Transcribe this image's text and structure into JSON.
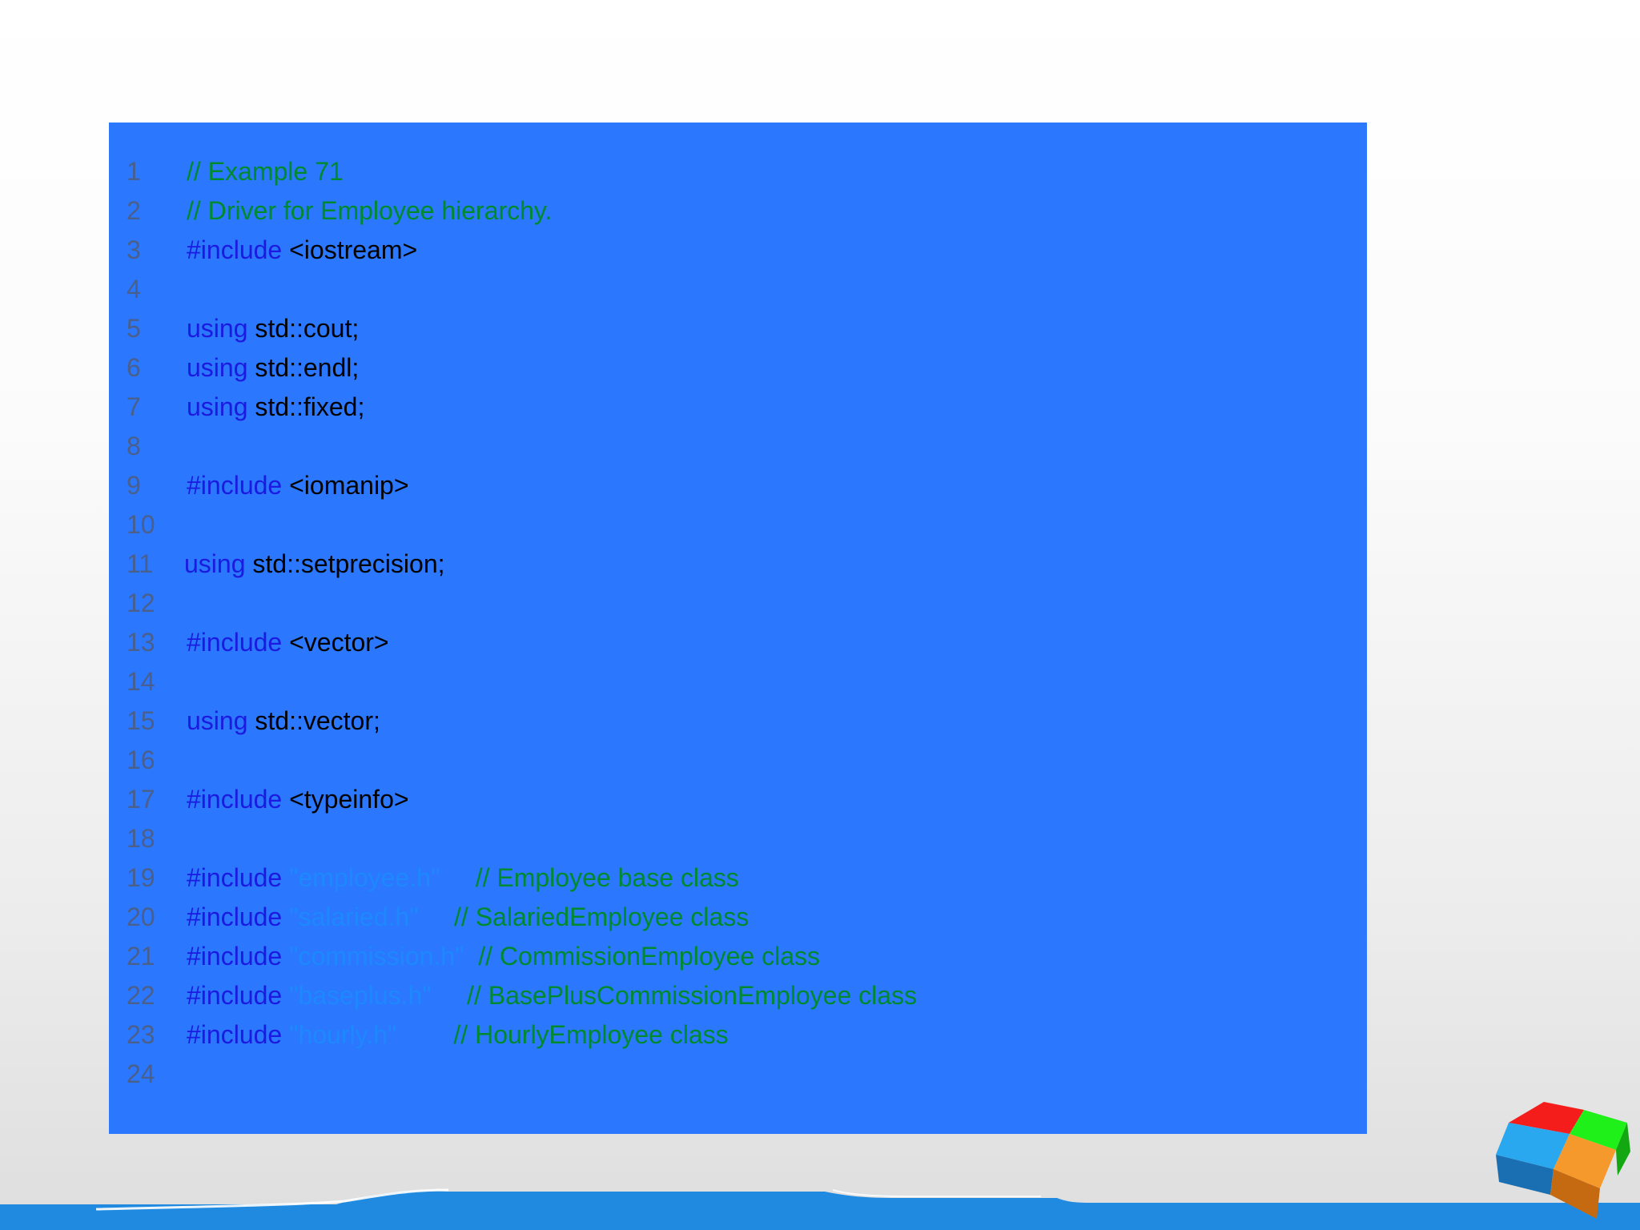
{
  "code": {
    "lines": [
      {
        "num": "1",
        "tokens": [
          {
            "t": "comment",
            "v": "// Example 71"
          }
        ]
      },
      {
        "num": "2",
        "tokens": [
          {
            "t": "comment",
            "v": "// Driver for Employee hierarchy."
          }
        ]
      },
      {
        "num": "3",
        "tokens": [
          {
            "t": "keyword",
            "v": "#include"
          },
          {
            "t": "text",
            "v": " <iostream>"
          }
        ]
      },
      {
        "num": "4",
        "tokens": []
      },
      {
        "num": "5",
        "tokens": [
          {
            "t": "keyword",
            "v": "using"
          },
          {
            "t": "text",
            "v": " std::cout;"
          }
        ]
      },
      {
        "num": "6",
        "tokens": [
          {
            "t": "keyword",
            "v": "using"
          },
          {
            "t": "text",
            "v": " std::endl;"
          }
        ]
      },
      {
        "num": "7",
        "tokens": [
          {
            "t": "keyword",
            "v": "using"
          },
          {
            "t": "text",
            "v": " std::fixed;"
          }
        ]
      },
      {
        "num": "8",
        "tokens": []
      },
      {
        "num": "9",
        "tokens": [
          {
            "t": "keyword",
            "v": "#include"
          },
          {
            "t": "text",
            "v": " <iomanip>"
          }
        ]
      },
      {
        "num": "10",
        "tokens": []
      },
      {
        "num": "11",
        "tokens": [
          {
            "t": "keyword",
            "v": "using"
          },
          {
            "t": "text",
            "v": " std::setprecision;"
          }
        ]
      },
      {
        "num": "12",
        "tokens": []
      },
      {
        "num": "13",
        "tokens": [
          {
            "t": "keyword",
            "v": "#include"
          },
          {
            "t": "text",
            "v": " <vector>"
          }
        ]
      },
      {
        "num": "14",
        "tokens": []
      },
      {
        "num": "15",
        "tokens": [
          {
            "t": "keyword",
            "v": "using"
          },
          {
            "t": "text",
            "v": " std::vector;"
          }
        ]
      },
      {
        "num": "16",
        "tokens": []
      },
      {
        "num": "17",
        "tokens": [
          {
            "t": "keyword",
            "v": "#include"
          },
          {
            "t": "text",
            "v": " <typeinfo>"
          }
        ]
      },
      {
        "num": "18",
        "tokens": []
      },
      {
        "num": "19",
        "tokens": [
          {
            "t": "keyword",
            "v": "#include"
          },
          {
            "t": "string",
            "v": " \"employee.h\""
          },
          {
            "t": "comment",
            "v": "     // Employee base class"
          }
        ]
      },
      {
        "num": "20",
        "tokens": [
          {
            "t": "keyword",
            "v": "#include"
          },
          {
            "t": "string",
            "v": " \"salaried.h\""
          },
          {
            "t": "comment",
            "v": "     // SalariedEmployee class"
          }
        ]
      },
      {
        "num": "21",
        "tokens": [
          {
            "t": "keyword",
            "v": "#include"
          },
          {
            "t": "string",
            "v": " \"commission.h\""
          },
          {
            "t": "comment",
            "v": "  // CommissionEmployee class"
          }
        ]
      },
      {
        "num": "22",
        "tokens": [
          {
            "t": "keyword",
            "v": "#include"
          },
          {
            "t": "string",
            "v": " \"baseplus.h\""
          },
          {
            "t": "comment",
            "v": "     // BasePlusCommissionEmployee class"
          }
        ]
      },
      {
        "num": "23",
        "tokens": [
          {
            "t": "keyword",
            "v": "#include"
          },
          {
            "t": "string",
            "v": " \"hourly.h\""
          },
          {
            "t": "comment",
            "v": "        // HourlyEmployee class"
          }
        ]
      },
      {
        "num": "24",
        "tokens": []
      }
    ]
  },
  "colors": {
    "panel_background": "#2b77fd",
    "line_number": "#4a5f8a",
    "keyword": "#1a1ae0",
    "text": "#000000",
    "comment": "#008a2e",
    "string": "#1e88ff",
    "footer_band": "#1f8ae0"
  },
  "icons": {
    "decoration": "color-cube-icon"
  }
}
